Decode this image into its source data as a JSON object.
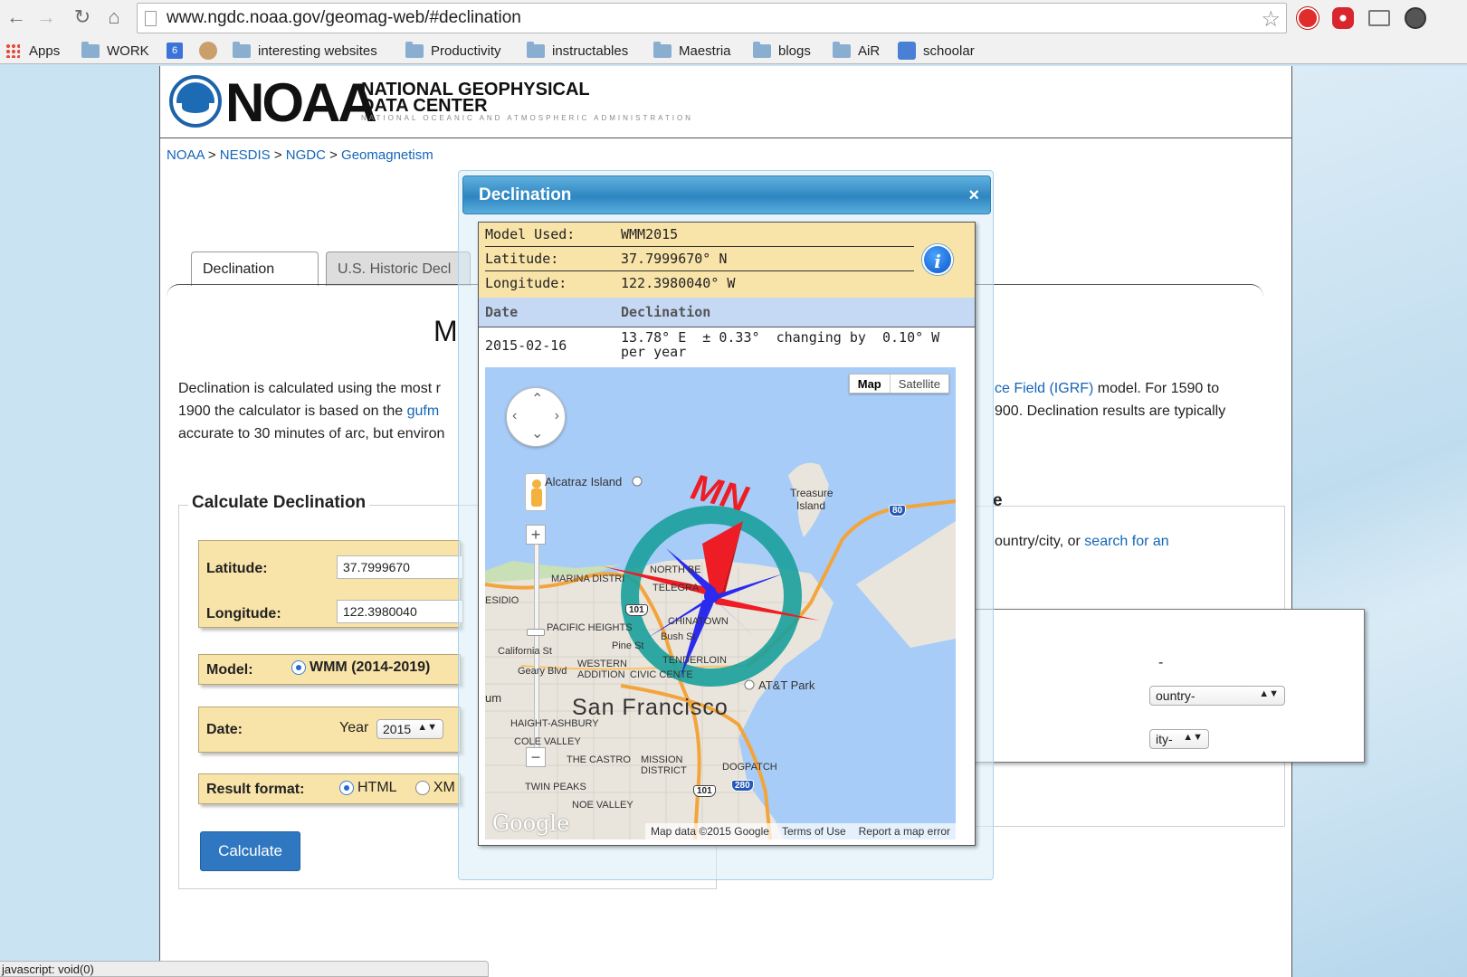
{
  "browser": {
    "url": "www.ngdc.noaa.gov/geomag-web/#declination",
    "status_text": "javascript: void(0)"
  },
  "bookmarks": [
    {
      "label": "Apps",
      "icon": "apps-grid-icon"
    },
    {
      "label": "WORK",
      "icon": "folder-icon"
    },
    {
      "label": "6",
      "icon": "calendar-icon"
    },
    {
      "label": "",
      "icon": "extension-icon"
    },
    {
      "label": "interesting websites",
      "icon": "folder-icon"
    },
    {
      "label": "Productivity",
      "icon": "folder-icon"
    },
    {
      "label": "instructables",
      "icon": "folder-icon"
    },
    {
      "label": "Maestria",
      "icon": "folder-icon"
    },
    {
      "label": "blogs",
      "icon": "folder-icon"
    },
    {
      "label": "AiR",
      "icon": "folder-icon"
    },
    {
      "label": "schoolar",
      "icon": "google-scholar-icon"
    }
  ],
  "header": {
    "logo_word": "NOAA",
    "org_line1": "NATIONAL GEOPHYSICAL",
    "org_line2": "DATA CENTER",
    "org_line3": "NATIONAL OCEANIC AND ATMOSPHERIC ADMINISTRATION"
  },
  "breadcrumb": {
    "items": [
      "NOAA",
      "NESDIS",
      "NGDC",
      "Geomagnetism"
    ],
    "separator": ">"
  },
  "tabs": [
    "Declination",
    "U.S. Historic Decl"
  ],
  "main": {
    "heading_visible": "M",
    "desc_line1": "Declination is calculated using the most r",
    "desc_line1_link": "ce Field (IGRF)",
    "desc_line1_end": " model. For 1590 to",
    "desc_line2": "1900 the calculator is based on the ",
    "desc_line2_link": "gufm",
    "desc_line2_end": "900. Declination results are typically",
    "desc_line3": "accurate to 30 minutes of arc, but environ"
  },
  "calculator": {
    "title": "Calculate Declination",
    "latitude_label": "Latitude:",
    "latitude_value": "37.7999670",
    "longitude_label": "Longitude:",
    "longitude_value": "122.3980040",
    "model_label": "Model:",
    "model_option": "WMM (2014-2019)",
    "date_label": "Date:",
    "year_label": "Year",
    "year_value": "2015",
    "format_label": "Result format:",
    "format_html": "HTML",
    "format_xml": "XM",
    "button": "Calculate"
  },
  "location": {
    "title_fragment": "e",
    "text": "ountry/city, or ",
    "link": "search for an",
    "dash": "-",
    "country_select": "ountry-",
    "city_select": "ity-"
  },
  "dialog": {
    "title": "Declination",
    "close": "×",
    "model_key": "Model Used:",
    "model_value": "WMM2015",
    "lat_key": "Latitude:",
    "lat_value": "37.7999670° N",
    "lon_key": "Longitude:",
    "lon_value": "122.3980040° W",
    "info_icon": "i",
    "col_date": "Date",
    "col_decl": "Declination",
    "row_date": "2015-02-16",
    "row_decl_line1": "13.78° E  ± 0.33°  changing by  0.10° W",
    "row_decl_line2": "per year"
  },
  "map": {
    "type_map": "Map",
    "type_satellite": "Satellite",
    "compass_text": "MN",
    "city": "San Francisco",
    "labels": {
      "alcatraz": "Alcatraz Island",
      "treasure1": "Treasure",
      "treasure2": "Island",
      "marina": "MARINA DISTRI",
      "presidio": "ESIDIO",
      "pacific": "PACIFIC HEIGHTS",
      "california": "California St",
      "pine": "Pine St",
      "bush": "Bush St",
      "geary": "Geary Blvd",
      "western1": "WESTERN",
      "western2": "ADDITION",
      "civic": "CIVIC CENTE",
      "atat": "AT&T Park",
      "um": "um",
      "haight": "HAIGHT-ASHBURY",
      "cole": "COLE VALLEY",
      "castro": "THE CASTRO",
      "mission1": "MISSION",
      "mission2": "DISTRICT",
      "dogpatch": "DOGPATCH",
      "twinpeaks": "TWIN PEAKS",
      "noe": "NOE VALLEY",
      "northbeach": "NORTH BE",
      "telegraph": "TELEGRA",
      "chinatown": "CHINATOWN",
      "tenderloin": "TENDERLOIN",
      "hwy101a": "101",
      "hwy101b": "101",
      "i80": "80",
      "i280": "280"
    },
    "footer_data": "Map data ©2015 Google",
    "footer_terms": "Terms of Use",
    "footer_report": "Report a map error",
    "google": "Google"
  },
  "colors": {
    "link": "#1565b7",
    "row_bg": "#f8e3a8",
    "button": "#2f78c1",
    "dialog_title": "#2e86c1",
    "compass_ring": "#1aa09c",
    "compass_red": "#ee1c24",
    "compass_blue": "#2b2bf0",
    "water": "#a8ccf8",
    "land": "#e9e5dc"
  }
}
